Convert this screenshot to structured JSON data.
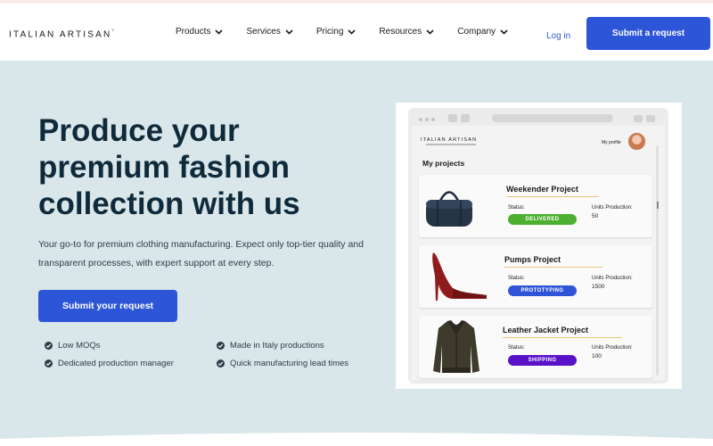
{
  "nav": {
    "logo": "ITALIAN ARTISAN",
    "logo_mark": "°",
    "menu": [
      {
        "label": "Products"
      },
      {
        "label": "Services"
      },
      {
        "label": "Pricing"
      },
      {
        "label": "Resources"
      },
      {
        "label": "Company"
      }
    ],
    "login": "Log in",
    "cta": "Submit a request"
  },
  "hero": {
    "title": "Produce your premium fashion collection with us",
    "subtitle": "Your go-to for premium clothing manufacturing. Expect only top-tier quality and transparent processes, with expert support at every step.",
    "button": "Submit your request",
    "features": [
      "Low MOQs",
      "Made in Italy productions",
      "Dedicated production manager",
      "Quick manufacturing lead times"
    ]
  },
  "mockup": {
    "logo": "ITALIAN ARTISAN",
    "profile_label": "My profile",
    "heading": "My projects",
    "projects": [
      {
        "title": "Weekender Project",
        "status_label": "Status:",
        "status": "DELIVERED",
        "status_color": "#4caf2f",
        "units_label": "Units Production:",
        "units": "50",
        "image": "duffel-bag-icon"
      },
      {
        "title": "Pumps Project",
        "status_label": "Status:",
        "status": "PROTOTYPING",
        "status_color": "#2f55d6",
        "units_label": "Units Production:",
        "units": "1500",
        "image": "high-heel-icon"
      },
      {
        "title": "Leather Jacket Project",
        "status_label": "Status:",
        "status": "SHIPPING",
        "status_color": "#5a12c9",
        "units_label": "Units Production:",
        "units": "100",
        "image": "jacket-icon"
      }
    ]
  },
  "colors": {
    "brand_blue": "#2d55d7",
    "hero_bg": "#d9e6ea",
    "title": "#0f2a3a"
  }
}
